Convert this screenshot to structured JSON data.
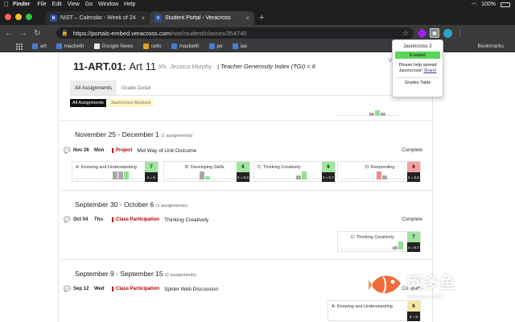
{
  "menubar": {
    "app": "Finder",
    "items": [
      "File",
      "Edit",
      "View",
      "Go",
      "Window",
      "Help"
    ],
    "battery": "100%"
  },
  "tabs": [
    {
      "favicon": "N",
      "title": "NIST – Calendar - Week of 24"
    },
    {
      "favicon": "V",
      "title": "Student Portal - Veracross"
    }
  ],
  "url": {
    "prefix": "https://portals-embed.veracross.com",
    "path": "/nist/student/classes/354740"
  },
  "bookmarks": [
    "art",
    "macbeth",
    "Google News",
    "cells",
    "macbeth",
    "pe",
    "ias"
  ],
  "bookmarks_other": "Bookmarks",
  "class": {
    "code": "11-ART.01:",
    "name": "Art 11",
    "teacher": "Ms. Jessica Murphy",
    "tgi": "| Teacher Generosity Index (TGI) = 6",
    "edge_text": "Vi"
  },
  "page_tabs": {
    "all": "All Assignments",
    "detail": "Grade Detail"
  },
  "pills": {
    "all": "All Assignments",
    "analysis": "Jasoncross Analysis"
  },
  "weeks": [
    {
      "title": "November 25 - December 1",
      "count": "(1 assignments)",
      "assignment": {
        "date": "Nov 26",
        "day": "Mon",
        "type": "Project",
        "name": "Mid Way of Unit Outcome",
        "status": "Complete"
      },
      "criteria": [
        {
          "label": "A: Knowing and Understanding",
          "score": "7",
          "avg": "x̄ = 6"
        },
        {
          "label": "B: Developing Skills",
          "score": "6",
          "avg": "x̄ = 5.3"
        },
        {
          "label": "C: Thinking Creatively",
          "score": "6",
          "avg": "x̄ = 5.7"
        },
        {
          "label": "D: Responding",
          "score": "6",
          "avg": "x̄ = 6.3"
        }
      ]
    },
    {
      "title": "September 30 - October 6",
      "count": "(1 assignments)",
      "assignment": {
        "date": "Oct 04",
        "day": "Thu",
        "type": "Class Participation",
        "name": "Thinking Creatively",
        "status": "Complete"
      },
      "criteria": [
        {
          "label": "C: Thinking Creatively",
          "score": "7",
          "avg": "x̄ = 6.7"
        }
      ]
    },
    {
      "title": "September 9 - September 15",
      "count": "(2 assignments)",
      "assignment": {
        "date": "Sep 12",
        "day": "Wed",
        "type": "Class Participation",
        "name": "Spider Web Discussion",
        "status": "Complete"
      },
      "criteria": [
        {
          "label": "A: Knowing and Understanding",
          "score": "6",
          "avg": "x̄ = 6"
        }
      ]
    }
  ],
  "popup": {
    "title": "Jasoncross 2",
    "enabled": "Enabled",
    "msg_line1": "Please help spread",
    "msg_line2": "Jasoncross!",
    "share": "Share!",
    "grades_button": "Grades Table"
  },
  "watermark": {
    "cn": "网多鱼",
    "en": "wduoyu.com"
  },
  "colors": {
    "score_green": "#9fe69f",
    "score_red": "#f6a0a0",
    "score_yellow": "#f5e7a0",
    "bar_gray": "#a9a9a9",
    "bar_green": "#8fe08f",
    "bar_red": "#f08b8b"
  },
  "icons": {
    "apple": "apple-icon",
    "wifi": "wifi-icon",
    "lock": "lock-icon",
    "star": "star-icon",
    "comment": "comment-icon"
  }
}
